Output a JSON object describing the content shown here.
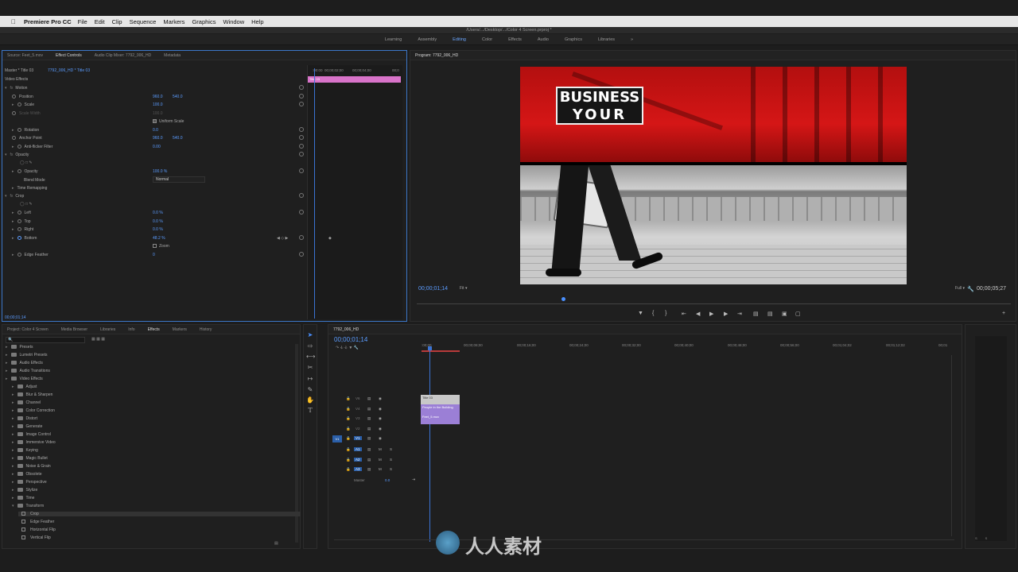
{
  "menubar": {
    "app": "Premiere Pro CC",
    "items": [
      "File",
      "Edit",
      "Clip",
      "Sequence",
      "Markers",
      "Graphics",
      "Window",
      "Help"
    ]
  },
  "titlebar": {
    "path": "/Users/.../Desktop/.../Color 4 Screen.prproj *"
  },
  "workspaces": [
    "Learning",
    "Assembly",
    "Editing",
    "Color",
    "Effects",
    "Audio",
    "Graphics",
    "Libraries"
  ],
  "active_workspace": "Editing",
  "source_panel": {
    "tabs": [
      "Source: Feet_5.mov",
      "Effect Controls",
      "Audio Clip Mixer: 7792_006_HD",
      "Metadata"
    ],
    "active_tab": "Effect Controls",
    "master_label": "Master * Title 03",
    "clip_label": "7792_006_HD * Title 03",
    "mini_clip": "Title 03",
    "ruler": [
      ":00:00",
      "00;00;02;00",
      "00;00;04;00",
      "00;0"
    ],
    "section": "Video Effects",
    "motion": {
      "label": "Motion",
      "rows": [
        {
          "name": "Position",
          "v1": "960.0",
          "v2": "540.0"
        },
        {
          "name": "Scale",
          "v1": "100.0",
          "v2": ""
        },
        {
          "name": "Scale Width",
          "v1": "100.0",
          "v2": ""
        },
        {
          "name": "Uniform Scale",
          "v1": "",
          "v2": ""
        },
        {
          "name": "Rotation",
          "v1": "0.0",
          "v2": ""
        },
        {
          "name": "Anchor Point",
          "v1": "960.0",
          "v2": "540.0"
        },
        {
          "name": "Anti-flicker Filter",
          "v1": "0.00",
          "v2": ""
        }
      ]
    },
    "opacity": {
      "label": "Opacity",
      "value": "100.0 %",
      "blend_label": "Blend Mode",
      "blend": "Normal"
    },
    "time_remap": "Time Remapping",
    "crop": {
      "label": "Crop",
      "rows": [
        {
          "name": "Left",
          "v": "0.0 %"
        },
        {
          "name": "Top",
          "v": "0.0 %"
        },
        {
          "name": "Right",
          "v": "0.0 %"
        },
        {
          "name": "Bottom",
          "v": "48.2 %"
        },
        {
          "name": "Zoom",
          "v": ""
        },
        {
          "name": "Edge Feather",
          "v": "0"
        }
      ]
    },
    "timecode": "00;00;01;14"
  },
  "program": {
    "title": "Program: 7792_006_HD",
    "timecode": "00;00;01;14",
    "fit": "Fit",
    "quality": "Full",
    "duration": "00;00;05;27",
    "frame_text": [
      "BUSINESS",
      "YOUR"
    ]
  },
  "project_panel": {
    "tabs": [
      "Project: Color 4 Screen",
      "Media Browser",
      "Libraries",
      "Info",
      "Effects",
      "Markers",
      "History"
    ],
    "active_tab": "Effects",
    "items": [
      {
        "label": "Presets",
        "indent": 0
      },
      {
        "label": "Lumetri Presets",
        "indent": 0
      },
      {
        "label": "Audio Effects",
        "indent": 0
      },
      {
        "label": "Audio Transitions",
        "indent": 0
      },
      {
        "label": "Video Effects",
        "indent": 0
      },
      {
        "label": "Adjust",
        "indent": 1
      },
      {
        "label": "Blur & Sharpen",
        "indent": 1
      },
      {
        "label": "Channel",
        "indent": 1
      },
      {
        "label": "Color Correction",
        "indent": 1
      },
      {
        "label": "Distort",
        "indent": 1
      },
      {
        "label": "Generate",
        "indent": 1
      },
      {
        "label": "Image Control",
        "indent": 1
      },
      {
        "label": "Immersive Video",
        "indent": 1
      },
      {
        "label": "Keying",
        "indent": 1
      },
      {
        "label": "Magic Bullet",
        "indent": 1
      },
      {
        "label": "Noise & Grain",
        "indent": 1
      },
      {
        "label": "Obsolete",
        "indent": 1
      },
      {
        "label": "Perspective",
        "indent": 1
      },
      {
        "label": "Stylize",
        "indent": 1
      },
      {
        "label": "Time",
        "indent": 1
      },
      {
        "label": "Transform",
        "indent": 1
      },
      {
        "label": "Crop",
        "indent": 2
      },
      {
        "label": "Edge Feather",
        "indent": 2
      },
      {
        "label": "Horizontal Flip",
        "indent": 2
      },
      {
        "label": "Vertical Flip",
        "indent": 2
      }
    ]
  },
  "timeline": {
    "tab": "7792_006_HD",
    "timecode": "00;00;01;14",
    "ruler": [
      ":00;00",
      "00;00;08;00",
      "00;00;16;00",
      "00;00;24;00",
      "00;00;32;00",
      "00;00;40;00",
      "00;00;48;00",
      "00;00;56;00",
      "00;01;04;02",
      "00;01;12;02",
      "00;01"
    ],
    "video_tracks": [
      "V6",
      "V4",
      "V3",
      "V2",
      "V1"
    ],
    "audio_tracks": [
      "A1",
      "A2",
      "A3"
    ],
    "master_label": "Master",
    "master_value": "0.0",
    "clips": [
      {
        "label": "Title 03",
        "color": "#c8c8c8"
      },
      {
        "label": "People in the Building",
        "color": "#9b7fd6"
      },
      {
        "label": "Feet_5.mov",
        "color": "#9b7fd6"
      }
    ]
  },
  "watermark": "人人素材",
  "colors": {
    "accent": "#3c77c9",
    "clip_purple": "#9b7fd6",
    "pink": "#d873c9"
  }
}
